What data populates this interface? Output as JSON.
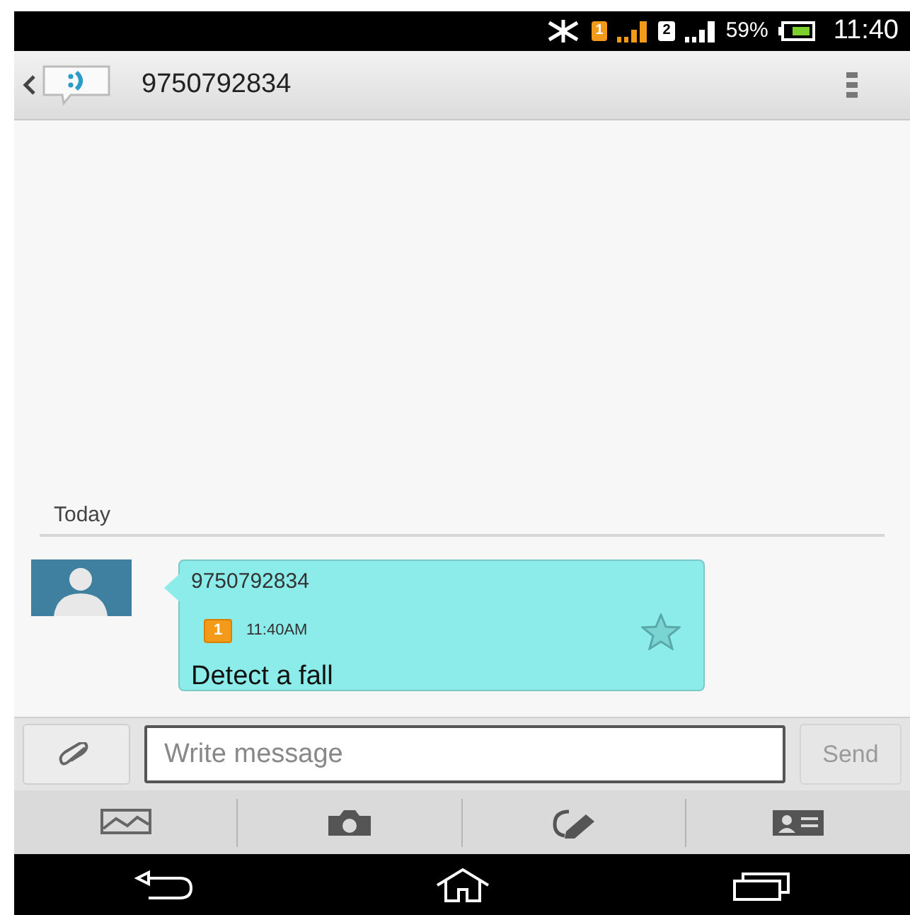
{
  "status_bar": {
    "sim_1": "1",
    "sim_2": "2",
    "battery": "59%",
    "time": "11:40"
  },
  "header": {
    "title": "9750792834"
  },
  "conversation": {
    "date_divider": "Today",
    "messages": [
      {
        "sender": "9750792834",
        "sim": "1",
        "time": "11:40AM",
        "text": "Detect a fall",
        "starred": false
      }
    ]
  },
  "composer": {
    "placeholder": "Write message",
    "send": {
      "label": "Send",
      "disabled": true
    }
  }
}
